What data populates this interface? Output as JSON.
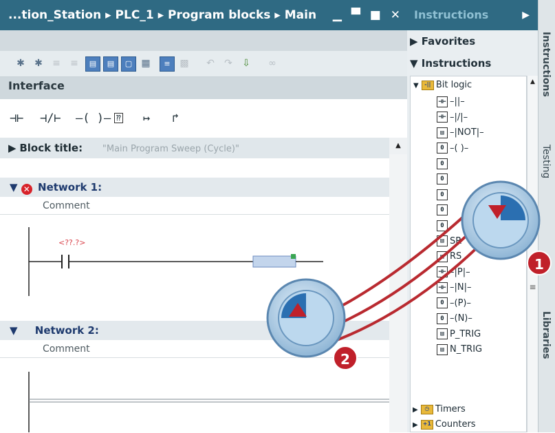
{
  "editor": {
    "title": "...tion_Station ▸ PLC_1 ▸ Program blocks ▸ Main",
    "window_controls": "▁ ▀ ■ ✕",
    "interface_label": "Interface",
    "ladder_palette": [
      "⊣⊢",
      "⊣/⊢",
      "–( )–",
      "⁇",
      "↦",
      "↱"
    ],
    "block_title_label": "Block title:",
    "block_title_value": "\"Main Program Sweep (Cycle)\"",
    "networks": [
      {
        "label": "Network 1:",
        "comment": "Comment",
        "has_error": true,
        "contact_operand": "<??.?>"
      },
      {
        "label": "Network 2:",
        "comment": "Comment",
        "has_error": false
      }
    ]
  },
  "instructions_panel": {
    "header": "Instructions",
    "favorites": "Favorites",
    "instructions": "Instructions",
    "bit_logic": "Bit logic",
    "items": [
      {
        "icon": "-||-",
        "label": "–||–"
      },
      {
        "icon": "-|/|-",
        "label": "–|/|–"
      },
      {
        "icon": "-|NOT|-",
        "label": "–|NOT|–"
      },
      {
        "icon": "-( )-",
        "label": "–( )–"
      },
      {
        "icon": "-( )-",
        "label": ""
      },
      {
        "icon": "-( )-",
        "label": ""
      },
      {
        "icon": "-( )-",
        "label": ""
      },
      {
        "icon": "-( )-",
        "label": ""
      },
      {
        "icon": "-( )-",
        "label": ""
      },
      {
        "icon": "SR",
        "label": "SR"
      },
      {
        "icon": "RS",
        "label": "RS"
      },
      {
        "icon": "-|P|-",
        "label": "–|P|–"
      },
      {
        "icon": "-|N|-",
        "label": "–|N|–"
      },
      {
        "icon": "-(P)-",
        "label": "–(P)–"
      },
      {
        "icon": "-(N)-",
        "label": "–(N)–"
      },
      {
        "icon": "P_TRIG",
        "label": "P_TRIG"
      },
      {
        "icon": "N_TRIG",
        "label": "N_TRIG"
      }
    ],
    "timers": "Timers",
    "counters": "Counters"
  },
  "side_tabs": [
    "Instructions",
    "Testing",
    "Libraries"
  ],
  "callouts": [
    "1",
    "2"
  ],
  "colors": {
    "title_bar": "#2f6a83",
    "network_label": "#1e3a6e",
    "error": "#d8232a",
    "callout": "#c0202a"
  }
}
